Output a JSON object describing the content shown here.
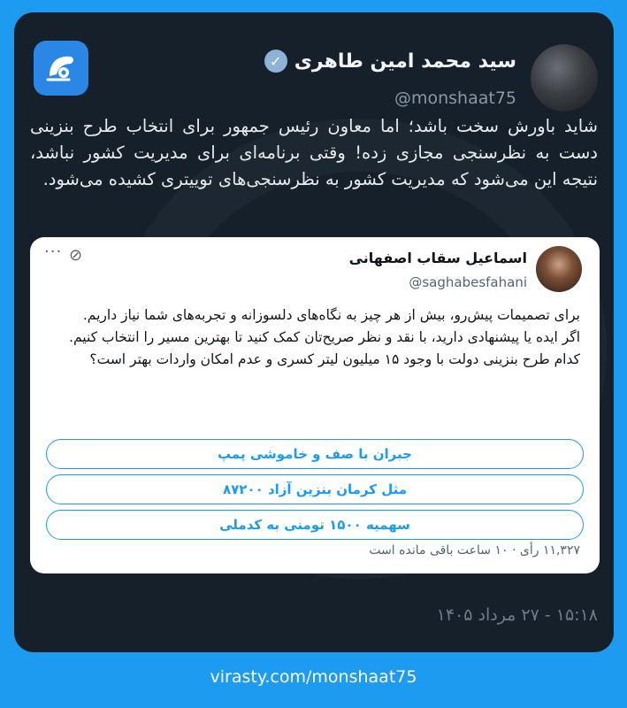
{
  "post": {
    "author_name": "سید محمد امین طاهری",
    "author_handle": "@monshaat75",
    "text": "شاید باورش سخت باشد؛ اما معاون رئیس جمهور برای انتخاب طرح بنزینی دست به نظرسنجی مجازی زده! وقتی برنامه‌ای برای مدیریت کشور نباشد، نتیجه این می‌شود که مدیریت کشور به نظرسنجی‌های توییتری کشیده می‌شود.",
    "timestamp": "۱۵:۱۸ - ۲۷ مرداد ۱۴۰۵"
  },
  "quote": {
    "author_name": "اسماعیل سقاب اصفهانی",
    "author_handle": "@saghabesfahani",
    "paragraphs": [
      "برای تصمیمات پیش‌رو، بیش از هر چیز به نگاه‌های دلسوزانه و تجربه‌های شما نیاز داریم.",
      "اگر ایده یا پیشنهادی دارید، با نقد و نظر صریح‌تان کمک کنید تا بهترین مسیر را انتخاب کنیم.",
      "کدام طرح بنزینی دولت با وجود ۱۵ میلیون لیتر کسری و عدم امکان واردات بهتر است؟"
    ],
    "poll_options": [
      "جبران با صف و خاموشی پمپ",
      "مثل کرمان بنزین آزاد ۸۷۲۰۰",
      "سهمیه ۱۵۰۰ تومنی به کدملی"
    ],
    "poll_footer": "۱۱,۳۲۷ رأی · ۱۰ ساعت باقی مانده است"
  },
  "footer": {
    "url": "virasty.com/monshaat75"
  },
  "colors": {
    "outer_bg": "#1d9bf0",
    "card_bg": "#15202b",
    "accent": "#1d9bf0"
  }
}
